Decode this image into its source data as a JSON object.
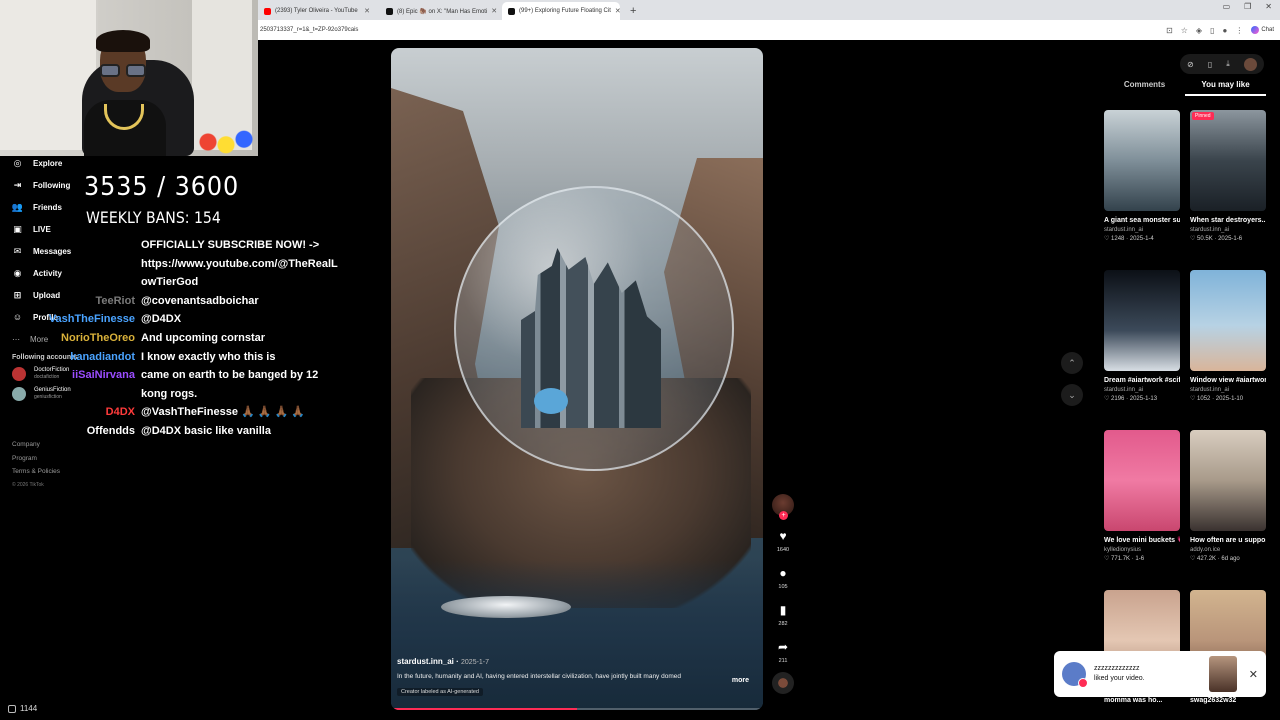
{
  "browser": {
    "tabs": [
      {
        "label": "(2393) Tyler Oliveira - YouTube",
        "color": "#ff0000",
        "active": false
      },
      {
        "label": "(8) Epic 🦣 on X: \"Man Has Emoti",
        "color": "#111111",
        "active": false
      },
      {
        "label": "(99+) Exploring Future Floating Cit",
        "color": "#111111",
        "active": true
      }
    ],
    "new_tab": "+",
    "url": "2503713337_r=1&_t=ZP-92o379cais",
    "chat_label": "Chat"
  },
  "sidebar": {
    "items": [
      {
        "label": "Explore",
        "icon": "compass-icon",
        "glyph": "◎"
      },
      {
        "label": "Following",
        "icon": "following-icon",
        "glyph": "⇥"
      },
      {
        "label": "Friends",
        "icon": "friends-icon",
        "glyph": "👥"
      },
      {
        "label": "LIVE",
        "icon": "live-icon",
        "glyph": "▣"
      },
      {
        "label": "Messages",
        "icon": "messages-icon",
        "glyph": "✉"
      },
      {
        "label": "Activity",
        "icon": "activity-icon",
        "glyph": "◉"
      },
      {
        "label": "Upload",
        "icon": "upload-icon",
        "glyph": "⊞"
      },
      {
        "label": "Profile",
        "icon": "profile-icon",
        "glyph": "☺"
      }
    ],
    "more_label": "More",
    "following_accounts_label": "Following accounts",
    "following_accounts": [
      {
        "name": "DoctorFiction",
        "handle": "doctafiction"
      },
      {
        "name": "GeniusFiction",
        "handle": "geniusfiction"
      }
    ],
    "footer_links": [
      "Company",
      "Program",
      "Terms & Policies"
    ],
    "copyright": "© 2026 TikTok"
  },
  "overlay": {
    "counter": "3535 / 3600",
    "weekly_bans": "WEEKLY BANS: 154"
  },
  "chat": [
    {
      "user": "",
      "color": "#ffffff",
      "msg": "OFFICIALLY SUBSCRIBE NOW! ->"
    },
    {
      "user": "",
      "color": "#ffffff",
      "msg": "https://www.youtube.com/@TheRealL"
    },
    {
      "user": "",
      "color": "#ffffff",
      "msg": "owTierGod"
    },
    {
      "user": "TeeRiot",
      "color": "#7a7a7a",
      "msg": "@covenantsadboichar"
    },
    {
      "user": "VashTheFinesse",
      "color": "#4aa3ff",
      "msg": "@D4DX"
    },
    {
      "user": "NorioTheOreo",
      "color": "#d9b13a",
      "msg": "And upcoming cornstar"
    },
    {
      "user": "kanadiandot",
      "color": "#4aa3ff",
      "msg": "I know exactly who this is"
    },
    {
      "user": "iiSaiNirvana",
      "color": "#9b4dff",
      "msg": "came on earth to be banged by 12"
    },
    {
      "user": "",
      "color": "#ffffff",
      "msg": "kong rogs."
    },
    {
      "user": "D4DX",
      "color": "#ff3b3b",
      "msg": "@VashTheFinesse 🙏🏾 🙏🏾 🙏🏾 🙏🏾"
    },
    {
      "user": "Offendds",
      "color": "#ffffff",
      "msg": "@D4DX basic like vanilla"
    }
  ],
  "video": {
    "author": "stardust.inn_ai",
    "date": "2025-1-7",
    "description": "In the future, humanity and AI, having entered interstellar civilization, have jointly built many domed",
    "more_label": "more",
    "ai_label": "Creator labeled as AI-generated",
    "progress": 0.5
  },
  "actions": {
    "likes": "1640",
    "comments": "105",
    "saves": "282",
    "shares": "211"
  },
  "right_panel": {
    "tabs": [
      "Comments",
      "You may like"
    ],
    "active_tab": 1,
    "cards": [
      {
        "title": "A giant sea monster suddenl...",
        "author": "stardust.inn_ai",
        "likes": "1248",
        "date": "2025-1-4",
        "pinned": "",
        "bg": "linear-gradient(180deg,#c9d2d6,#7f8f99 50%,#33424c)"
      },
      {
        "title": "When star destroyers...",
        "author": "stardust.inn_ai",
        "likes": "50.5K",
        "date": "2025-1-6",
        "pinned": "Pinned",
        "bg": "linear-gradient(180deg,#8c969e,#3a444c 50%,#1a2026)"
      },
      {
        "title": "Dream #aiartwork #scifi...",
        "author": "stardust.inn_ai",
        "likes": "2196",
        "date": "2025-1-13",
        "pinned": "",
        "bg": "linear-gradient(180deg,#0c1016,#3c4a5a 60%,#d8dee4)"
      },
      {
        "title": "Window view #aiartwork #scifi...",
        "author": "stardust.inn_ai",
        "likes": "1052",
        "date": "2025-1-10",
        "pinned": "",
        "bg": "linear-gradient(180deg,#7fb3d9,#b7d2e4 55%,#d9b59a)"
      },
      {
        "title": "We love mini buckets 💗 ...",
        "author": "kylledionysius",
        "likes": "771.7K",
        "date": "1-6",
        "pinned": "",
        "bg": "linear-gradient(180deg,#e25a8c,#f07aa3 50%,#c9476f)"
      },
      {
        "title": "How often are u supposed to get...",
        "author": "addy.on.ice",
        "likes": "427.2K",
        "date": "6d ago",
        "pinned": "",
        "bg": "linear-gradient(180deg,#d8cdbf,#a89a8a 50%,#3a3230)"
      },
      {
        "title": "momma was ho...",
        "author": "",
        "likes": "",
        "date": "",
        "pinned": "",
        "bg": "linear-gradient(180deg,#c9a38e,#e4c7b3 50%,#a07a66)"
      },
      {
        "title": "swag2632w32",
        "author": "",
        "likes": "",
        "date": "",
        "pinned": "",
        "bg": "linear-gradient(180deg,#d2b48f,#b9957a 50%,#6a4a3a)"
      }
    ]
  },
  "toast": {
    "name": "zzzzzzzzzzzzz",
    "text": "liked your video."
  },
  "stream": {
    "viewers": "1144"
  }
}
